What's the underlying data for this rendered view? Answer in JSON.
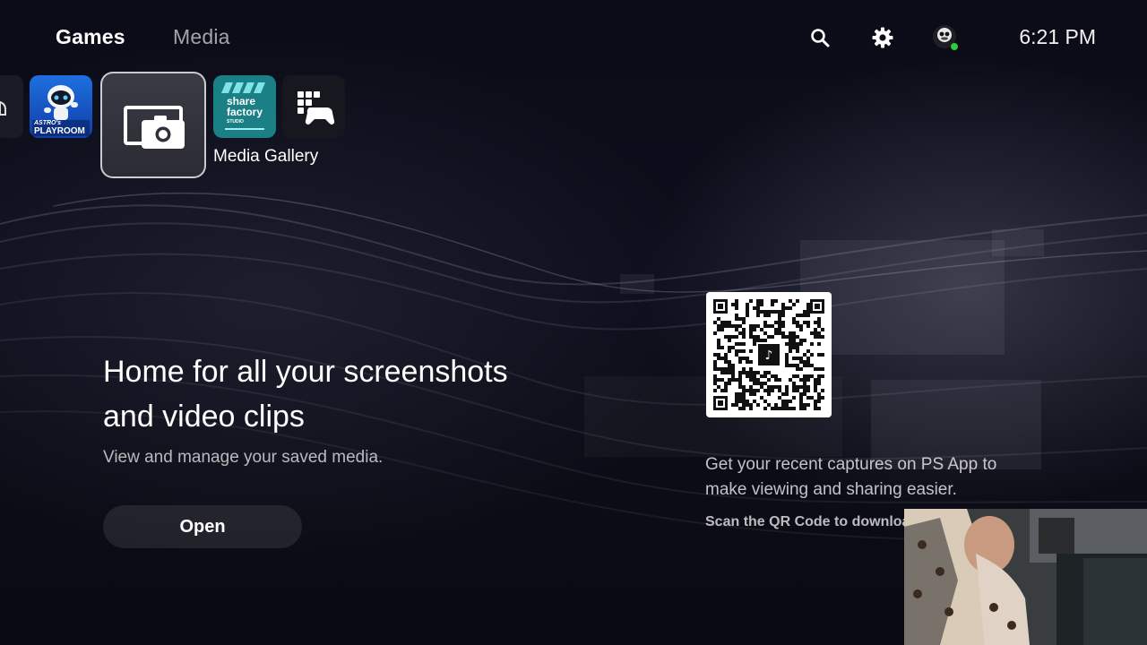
{
  "nav": {
    "tabs": [
      {
        "label": "Games",
        "active": true
      },
      {
        "label": "Media",
        "active": false
      }
    ],
    "icons": [
      "search-icon",
      "gear-icon",
      "profile-avatar"
    ],
    "time": "6:21 PM",
    "online_status_color": "#2ecc40"
  },
  "tiles": {
    "items": [
      {
        "name": "partial-tile"
      },
      {
        "name": "astro-playroom",
        "lines": [
          "ASTRO's",
          "PLAYROOM"
        ]
      },
      {
        "name": "media-gallery",
        "selected": true
      },
      {
        "name": "share-factory",
        "lines": [
          "share",
          "factory",
          "STUDIO"
        ]
      },
      {
        "name": "game-base"
      }
    ],
    "focused_label": "Media Gallery"
  },
  "main": {
    "headline_line1": "Home for all your screenshots",
    "headline_line2": "and video clips",
    "subtext": "View and manage your saved media.",
    "open_label": "Open"
  },
  "qr": {
    "description_line1": "Get your recent captures on PS App to",
    "description_line2": "make viewing and sharing easier.",
    "scan_text": "Scan the QR Code to download"
  },
  "colors": {
    "accent": "#ffffff",
    "background": "#0b0c18"
  }
}
